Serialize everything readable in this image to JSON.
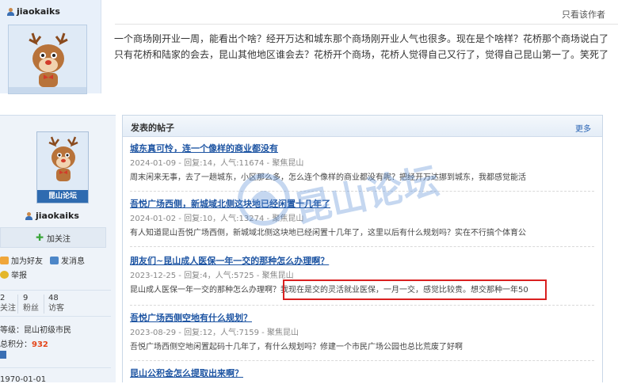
{
  "top_post": {
    "username": "jiaokaiks",
    "only_author_label": "只看该作者",
    "content": "一个商场刚开业一周，能看出个啥？经开万达和城东那个商场刚开业人气也很多。现在是个啥样？花桥那个商场说白了只有花桥和陆家的会去，昆山其他地区谁会去？花桥开个商场，花桥人觉得自己又行了，觉得自己昆山第一了。笑死了"
  },
  "profile": {
    "avatar_banner": "昆山论坛",
    "username": "jiaokaiks",
    "follow_label": "加关注",
    "actions": {
      "add_friend": "加为好友",
      "send_message": "发消息",
      "report": "举报"
    },
    "stats": [
      {
        "value": "2",
        "label": "关注"
      },
      {
        "value": "9",
        "label": "粉丝"
      },
      {
        "value": "48",
        "label": "访客"
      }
    ],
    "level": "等级：昆山初级市民",
    "points_label": "总积分：",
    "points_value": "932",
    "join_date": "1970-01-01"
  },
  "threads_panel": {
    "title": "发表的帖子",
    "more_label": "更多",
    "threads": [
      {
        "title": "城东真可怜，连一个像样的商业都没有",
        "meta": "2024-01-09 - 回复:14，人气:11674 - 聚焦昆山",
        "summary": "周末闲来无事，去了一趟城东，小区那么多，怎么连个像样的商业都没有呢？把经开万达挪到城东，我都感觉能活"
      },
      {
        "title": "吾悦广场西侧，新城域北侧这块地已经闲置十几年了",
        "meta": "2024-01-02 - 回复:10，人气:13274 - 聚焦昆山",
        "summary": "有人知道昆山吾悦广场西侧，新城域北侧这块地已经闲置十几年了，这里以后有什么规划吗？实在不行搞个体育公"
      },
      {
        "title": "朋友们~昆山成人医保一年一交的那种怎么办理啊？",
        "meta": "2023-12-25 - 回复:4，人气:5725 - 聚焦昆山",
        "summary_a": "昆山成人医保一年一交的那种怎么办理啊？",
        "summary_b": "我现在是交的灵活就业医保，一月一交，感觉比较贵。想交那种一年50"
      },
      {
        "title": "吾悦广场西侧空地有什么规划？",
        "meta": "2023-08-29 - 回复:12，人气:7159 - 聚焦昆山",
        "summary": "吾悦广场西侧空地闲置起码十几年了，有什么规划吗？修建一个市民广场公园也总比荒废了好啊"
      },
      {
        "title": "昆山公积金怎么提取出来啊？"
      }
    ]
  },
  "watermark_text": "昆山论坛",
  "colors": {
    "link": "#1e55a3",
    "sidebar_bg": "#eef3f9",
    "highlight": "#d92020",
    "points": "#e4461a"
  }
}
